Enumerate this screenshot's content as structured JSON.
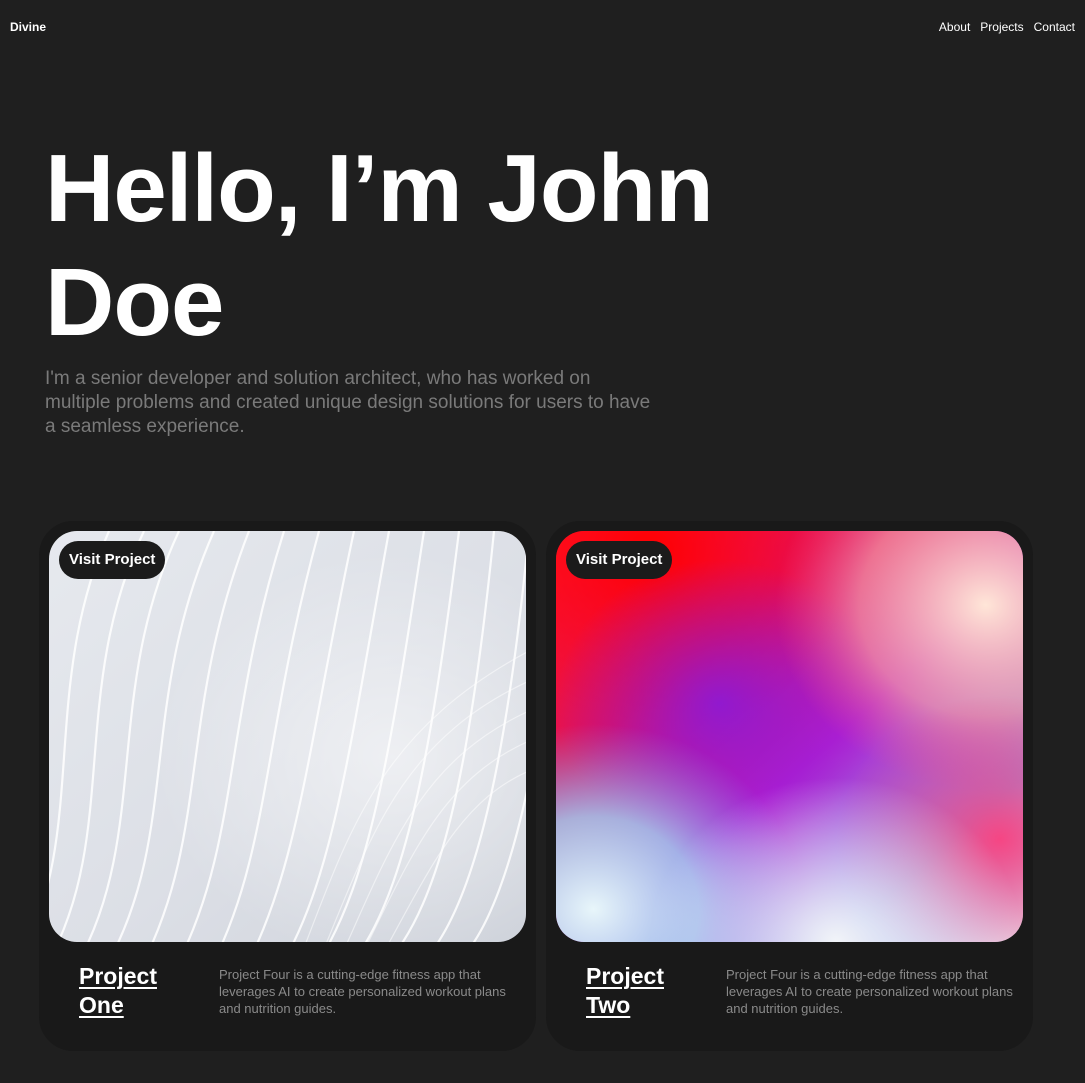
{
  "header": {
    "brand": "Divine",
    "nav": [
      {
        "label": "About"
      },
      {
        "label": "Projects"
      },
      {
        "label": "Contact"
      }
    ]
  },
  "hero": {
    "title": "Hello, I’m John Doe",
    "subtitle": "I'm a senior developer and solution architect, who has worked on multiple problems and created unique design solutions for users to have a seamless experience."
  },
  "projects": [
    {
      "button_label": "Visit Project",
      "title": "Project One",
      "description": "Project Four is a cutting-edge fitness app that leverages AI to create personalized workout plans and nutrition guides.",
      "image": "abstract-white-waves"
    },
    {
      "button_label": "Visit Project",
      "title": "Project Two",
      "description": "Project Four is a cutting-edge fitness app that leverages AI to create personalized workout plans and nutrition guides.",
      "image": "colorful-gradient"
    }
  ],
  "colors": {
    "background": "#1f1f1f",
    "card": "#191919",
    "text": "#ffffff",
    "muted_text": "#7a7a7a"
  }
}
